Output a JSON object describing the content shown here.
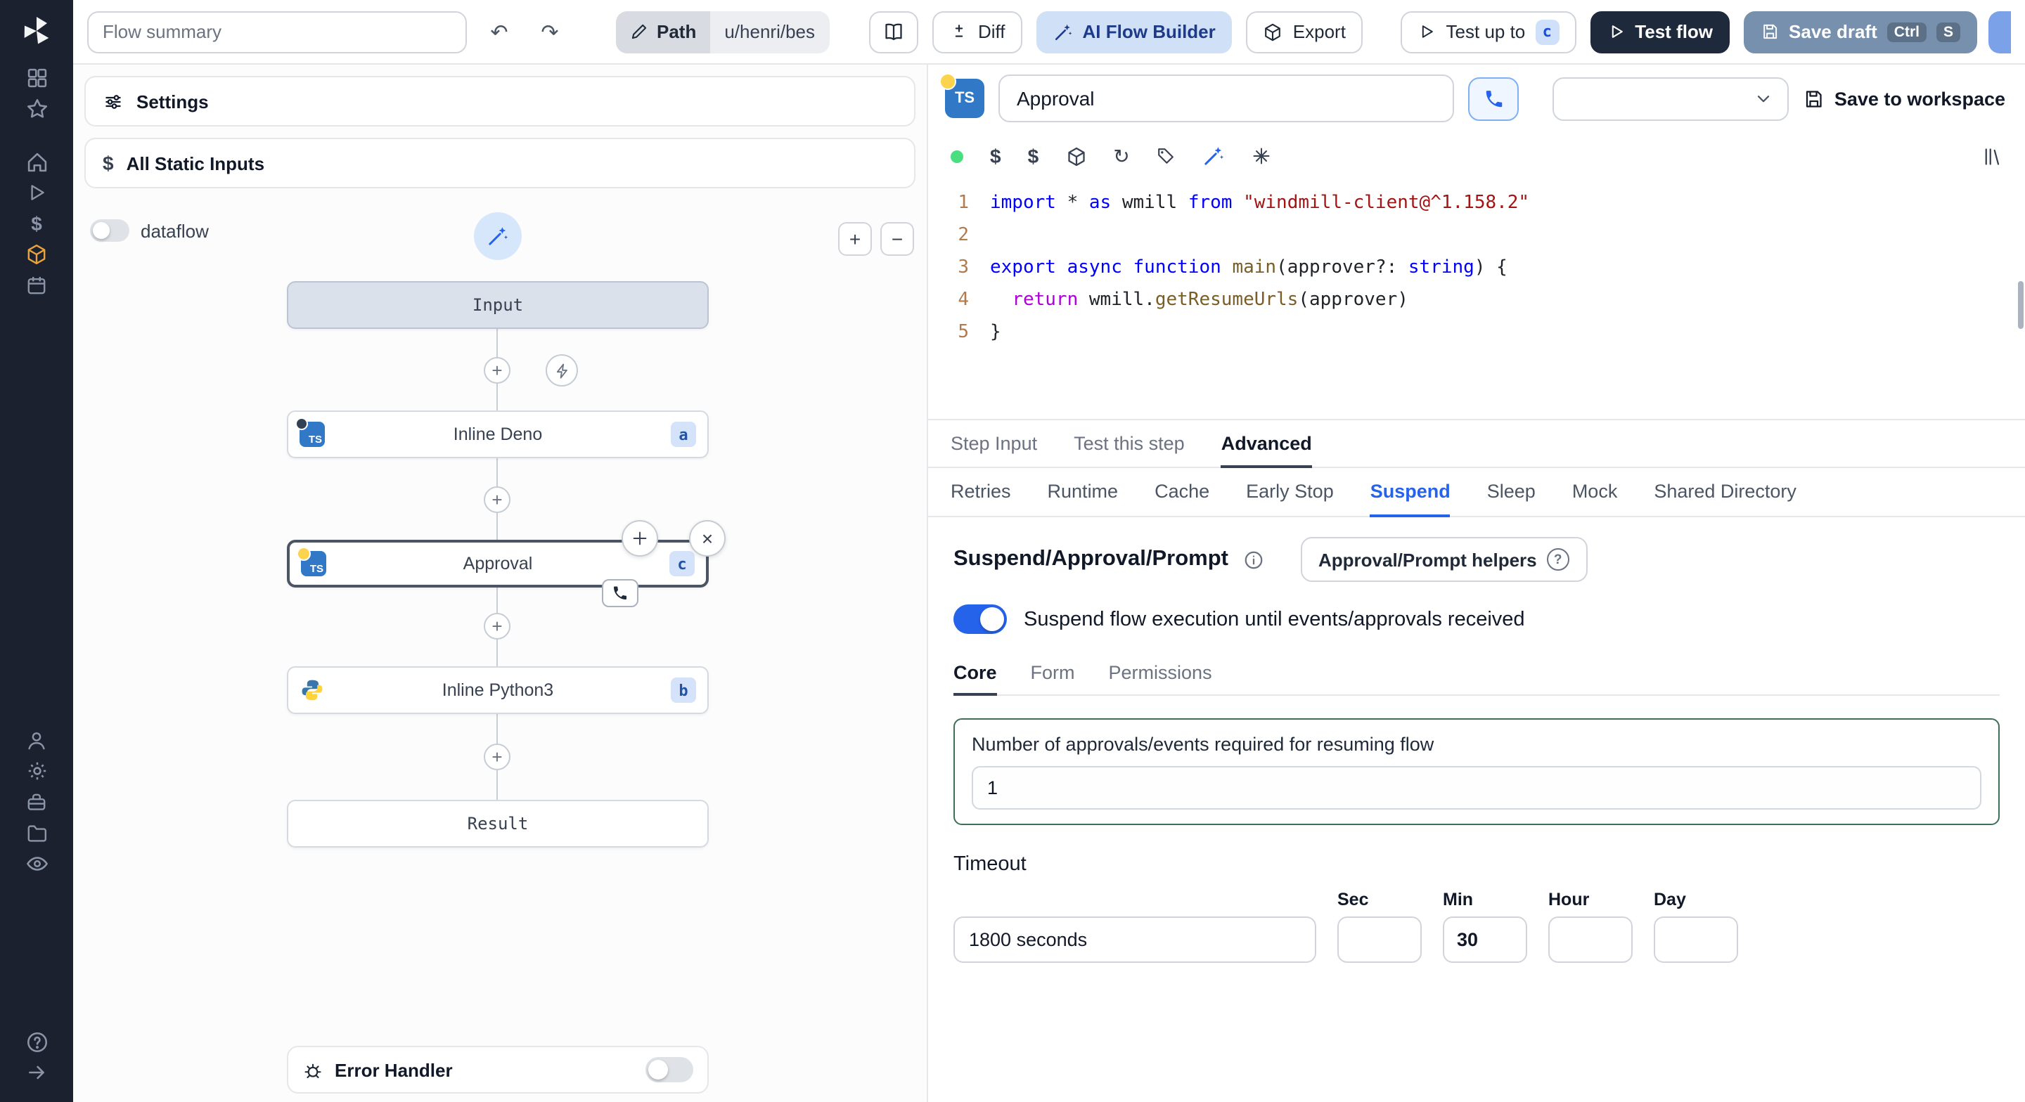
{
  "colors": {
    "accent": "#2563eb",
    "toggle_on": "#2563eb",
    "focus_green": "#3f6f57",
    "status_dot": "#4ade80",
    "badge_bg": "#d4e3f9",
    "badge_text": "#2553a3"
  },
  "topbar": {
    "flow_summary_placeholder": "Flow summary",
    "path_label": "Path",
    "path_value": "u/henri/bes",
    "diff_label": "Diff",
    "ai_flow_builder_label": "AI Flow Builder",
    "export_label": "Export",
    "test_up_to_label": "Test up to",
    "test_up_to_badge": "c",
    "test_flow_label": "Test flow",
    "save_draft_label": "Save draft",
    "save_draft_kbd": [
      "Ctrl",
      "S"
    ]
  },
  "flow_panel": {
    "settings_label": "Settings",
    "static_inputs_label": "All Static Inputs",
    "dataflow_label": "dataflow",
    "nodes": {
      "input_label": "Input",
      "deno_label": "Inline Deno",
      "deno_badge": "a",
      "approval_label": "Approval",
      "approval_badge": "c",
      "python_label": "Inline Python3",
      "python_badge": "b",
      "result_label": "Result"
    },
    "error_handler_label": "Error Handler"
  },
  "step": {
    "language_badge": "TS",
    "title_value": "Approval",
    "save_to_workspace_label": "Save to workspace"
  },
  "code": {
    "lines": [
      [
        {
          "t": "kw",
          "v": "import"
        },
        {
          "t": "plain",
          "v": " * "
        },
        {
          "t": "kw",
          "v": "as"
        },
        {
          "t": "plain",
          "v": " wmill "
        },
        {
          "t": "kw",
          "v": "from"
        },
        {
          "t": "plain",
          "v": " "
        },
        {
          "t": "str",
          "v": "\"windmill-client@^1.158.2\""
        }
      ],
      [],
      [
        {
          "t": "kw",
          "v": "export"
        },
        {
          "t": "plain",
          "v": " "
        },
        {
          "t": "kw",
          "v": "async"
        },
        {
          "t": "plain",
          "v": " "
        },
        {
          "t": "kw",
          "v": "function"
        },
        {
          "t": "plain",
          "v": " "
        },
        {
          "t": "fn",
          "v": "main"
        },
        {
          "t": "plain",
          "v": "(approver?: "
        },
        {
          "t": "kw",
          "v": "string"
        },
        {
          "t": "plain",
          "v": ") {"
        }
      ],
      [
        {
          "t": "plain",
          "v": "  "
        },
        {
          "t": "ctrl",
          "v": "return"
        },
        {
          "t": "plain",
          "v": " wmill."
        },
        {
          "t": "fn",
          "v": "getResumeUrls"
        },
        {
          "t": "plain",
          "v": "(approver)"
        }
      ],
      [
        {
          "t": "plain",
          "v": "}"
        }
      ]
    ]
  },
  "tabs": {
    "main": [
      "Step Input",
      "Test this step",
      "Advanced"
    ],
    "advanced": [
      "Retries",
      "Runtime",
      "Cache",
      "Early Stop",
      "Suspend",
      "Sleep",
      "Mock",
      "Shared Directory"
    ],
    "suspend_sub": [
      "Core",
      "Form",
      "Permissions"
    ]
  },
  "suspend": {
    "section_title": "Suspend/Approval/Prompt",
    "helpers_button_label": "Approval/Prompt helpers",
    "toggle_label": "Suspend flow execution until events/approvals received",
    "approvals_label": "Number of approvals/events required for resuming flow",
    "approvals_value": "1",
    "timeout_label": "Timeout",
    "timeout_value": "1800 seconds",
    "unit_labels": [
      "Sec",
      "Min",
      "Hour",
      "Day"
    ],
    "min_value": "30"
  }
}
